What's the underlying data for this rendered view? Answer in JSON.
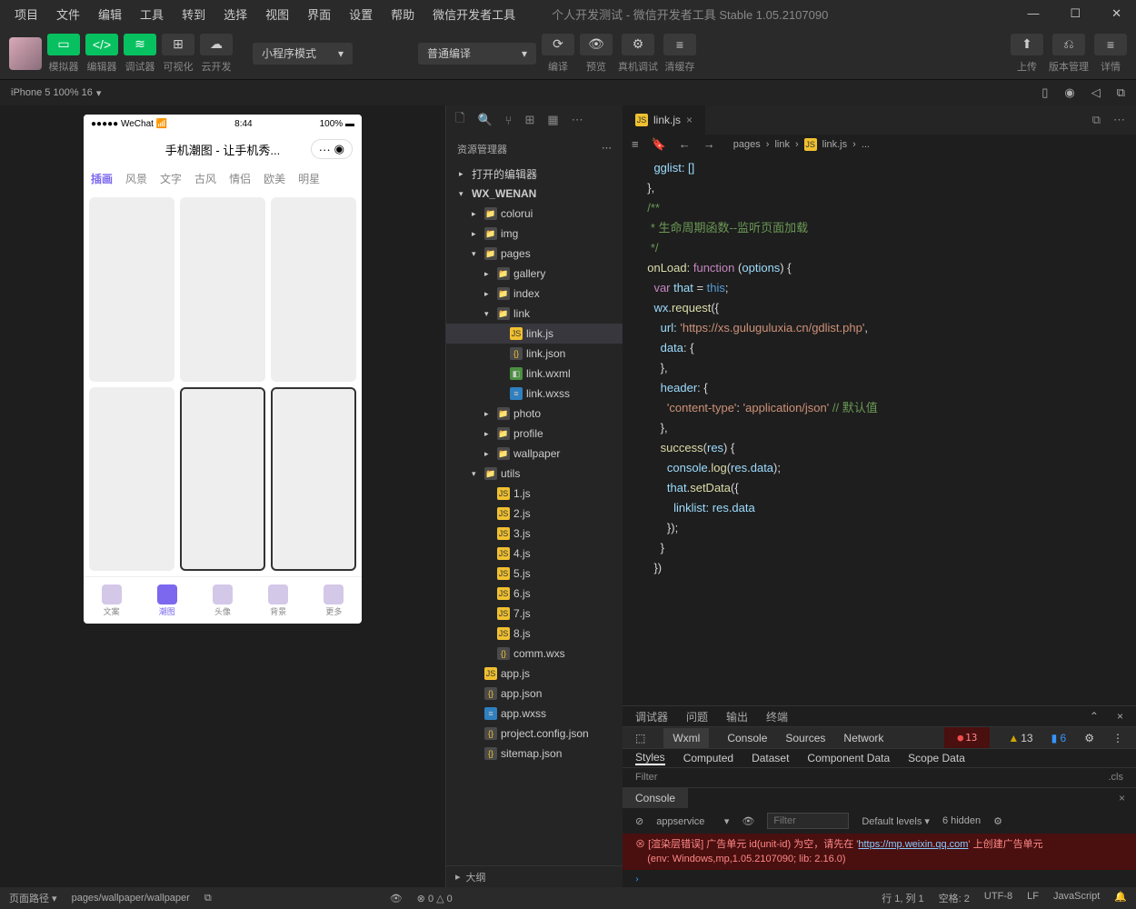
{
  "menubar": {
    "items": [
      "项目",
      "文件",
      "编辑",
      "工具",
      "转到",
      "选择",
      "视图",
      "界面",
      "设置",
      "帮助",
      "微信开发者工具"
    ],
    "title": "个人开发测试 - 微信开发者工具 Stable 1.05.2107090"
  },
  "toolbar": {
    "simulator": "模拟器",
    "editor": "编辑器",
    "debugger": "调试器",
    "visual": "可视化",
    "cloud": "云开发",
    "mode": "小程序模式",
    "compile": "普通编译",
    "compileBtn": "编译",
    "preview": "预览",
    "realdebug": "真机调试",
    "clearcache": "清缓存",
    "upload": "上传",
    "version": "版本管理",
    "detail": "详情"
  },
  "devicebar": {
    "device": "iPhone 5 100% 16"
  },
  "explorer": {
    "title": "资源管理器",
    "sections": {
      "openEditors": "打开的编辑器",
      "project": "WX_WENAN"
    },
    "tree": [
      {
        "name": "colorui",
        "type": "folder",
        "lvl": 2
      },
      {
        "name": "img",
        "type": "folder",
        "lvl": 2
      },
      {
        "name": "pages",
        "type": "folder",
        "lvl": 2,
        "open": true
      },
      {
        "name": "gallery",
        "type": "folder",
        "lvl": 3
      },
      {
        "name": "index",
        "type": "folder",
        "lvl": 3
      },
      {
        "name": "link",
        "type": "folder",
        "lvl": 3,
        "open": true
      },
      {
        "name": "link.js",
        "type": "js",
        "lvl": 4,
        "sel": true
      },
      {
        "name": "link.json",
        "type": "json",
        "lvl": 4
      },
      {
        "name": "link.wxml",
        "type": "wxml",
        "lvl": 4
      },
      {
        "name": "link.wxss",
        "type": "wxss",
        "lvl": 4
      },
      {
        "name": "photo",
        "type": "folder",
        "lvl": 3
      },
      {
        "name": "profile",
        "type": "folder",
        "lvl": 3
      },
      {
        "name": "wallpaper",
        "type": "folder",
        "lvl": 3
      },
      {
        "name": "utils",
        "type": "folder",
        "lvl": 2,
        "open": true
      },
      {
        "name": "1.js",
        "type": "js",
        "lvl": 3
      },
      {
        "name": "2.js",
        "type": "js",
        "lvl": 3
      },
      {
        "name": "3.js",
        "type": "js",
        "lvl": 3
      },
      {
        "name": "4.js",
        "type": "js",
        "lvl": 3
      },
      {
        "name": "5.js",
        "type": "js",
        "lvl": 3
      },
      {
        "name": "6.js",
        "type": "js",
        "lvl": 3
      },
      {
        "name": "7.js",
        "type": "js",
        "lvl": 3
      },
      {
        "name": "8.js",
        "type": "js",
        "lvl": 3
      },
      {
        "name": "comm.wxs",
        "type": "json",
        "lvl": 3
      },
      {
        "name": "app.js",
        "type": "js",
        "lvl": 2
      },
      {
        "name": "app.json",
        "type": "json",
        "lvl": 2
      },
      {
        "name": "app.wxss",
        "type": "wxss",
        "lvl": 2
      },
      {
        "name": "project.config.json",
        "type": "json",
        "lvl": 2
      },
      {
        "name": "sitemap.json",
        "type": "json",
        "lvl": 2
      }
    ],
    "outline": "大纲"
  },
  "editor": {
    "tabName": "link.js",
    "crumbs": [
      "pages",
      "link",
      "link.js",
      "..."
    ],
    "code": [
      {
        "t": "    gglist: []",
        "cls": "prop"
      },
      {
        "t": "  },",
        "cls": "pun"
      },
      {
        "t": "",
        "cls": ""
      },
      {
        "t": "  /**",
        "cls": "com"
      },
      {
        "t": "   * 生命周期函数--监听页面加载",
        "cls": "com"
      },
      {
        "t": "   */",
        "cls": "com"
      },
      {
        "t": "  onLoad: function (options) {",
        "cls": "mix1"
      },
      {
        "t": "    var that = this;",
        "cls": "mix2"
      },
      {
        "t": "    wx.request({",
        "cls": "mix3"
      },
      {
        "t": "      url: 'https://xs.guluguluxia.cn/gdlist.php',",
        "cls": "mix4"
      },
      {
        "t": "      data: {",
        "cls": "mix5"
      },
      {
        "t": "      },",
        "cls": "pun"
      },
      {
        "t": "      header: {",
        "cls": "mix5"
      },
      {
        "t": "        'content-type': 'application/json' // 默认值",
        "cls": "mix6"
      },
      {
        "t": "      },",
        "cls": "pun"
      },
      {
        "t": "      success(res) {",
        "cls": "mix7"
      },
      {
        "t": "        console.log(res.data);",
        "cls": "mix8"
      },
      {
        "t": "        that.setData({",
        "cls": "mix9"
      },
      {
        "t": "          linklist: res.data",
        "cls": "prop"
      },
      {
        "t": "        });",
        "cls": "pun"
      },
      {
        "t": "      }",
        "cls": "pun"
      },
      {
        "t": "    })",
        "cls": "pun"
      }
    ]
  },
  "debugger": {
    "toptabs": [
      "调试器",
      "问题",
      "输出",
      "终端"
    ],
    "panels": [
      "Wxml",
      "Console",
      "Sources",
      "Network"
    ],
    "errcount": "13",
    "warncount": "13",
    "infocount": "6",
    "styletabs": [
      "Styles",
      "Computed",
      "Dataset",
      "Component Data",
      "Scope Data"
    ],
    "filter": "Filter",
    "cls": ".cls",
    "consoleTitle": "Console",
    "context": "appservice",
    "levels": "Default levels",
    "hidden": "6 hidden",
    "errmsg1": "[渲染层错误] 广告单元 id(unit-id) 为空，请先在 '",
    "errlink": "https://mp.weixin.qq.com",
    "errmsg1b": "' 上创建广告单元",
    "errmsg2": "(env: Windows,mp,1.05.2107090; lib: 2.16.0)"
  },
  "phone": {
    "statusLeft": "●●●●● WeChat",
    "time": "8:44",
    "statusRight": "100%",
    "title": "手机潮图 - 让手机秀...",
    "tabs": [
      "插画",
      "风景",
      "文字",
      "古风",
      "情侣",
      "欧美",
      "明星"
    ],
    "nav": [
      "文案",
      "潮图",
      "头像",
      "背景",
      "更多"
    ]
  },
  "statusbar": {
    "pathlabel": "页面路径",
    "path": "pages/wallpaper/wallpaper",
    "errors": "0",
    "warnings": "0",
    "pos": "行 1, 列 1",
    "spaces": "空格: 2",
    "enc": "UTF-8",
    "eol": "LF",
    "lang": "JavaScript"
  }
}
